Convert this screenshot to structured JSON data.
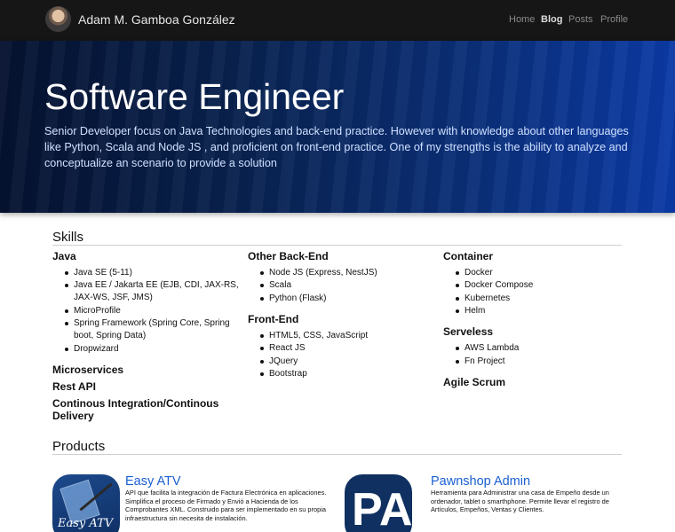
{
  "navbar": {
    "brand": "Adam M. Gamboa González",
    "links": [
      {
        "label": "Home",
        "active": false
      },
      {
        "label": "Blog",
        "active": true
      },
      {
        "label": "Posts",
        "active": false
      },
      {
        "label": "Profile",
        "active": false
      }
    ]
  },
  "hero": {
    "title": "Software Engineer",
    "description": "Senior Developer focus on Java Technologies and back-end practice. However with knowledge about other languages like Python, Scala and Node JS , and proficient on front-end practice. One of my strengths is the ability to analyze and conceptualize an scenario to provide a solution"
  },
  "skills": {
    "title": "Skills",
    "col1": {
      "java": {
        "title": "Java",
        "items": [
          "Java SE (5-11)",
          "Java EE / Jakarta EE (EJB, CDI, JAX-RS,",
          "JAX-WS, JSF, JMS)",
          "MicroProfile",
          "Spring Framework (Spring Core, Spring",
          "boot, Spring Data)",
          "Dropwizard"
        ]
      },
      "microservices": "Microservices",
      "rest": "Rest API",
      "ci_line1": "Continous Integration/Continous",
      "ci_line2": "Delivery"
    },
    "col2": {
      "backend": {
        "title": "Other Back-End",
        "items": [
          "Node JS (Express, NestJS)",
          "Scala",
          "Python (Flask)"
        ]
      },
      "frontend": {
        "title": "Front-End",
        "items": [
          "HTML5, CSS, JavaScript",
          "React JS",
          "JQuery",
          "Bootstrap"
        ]
      }
    },
    "col3": {
      "container": {
        "title": "Container",
        "items": [
          "Docker",
          "Docker Compose",
          "Kubernetes",
          "Helm"
        ]
      },
      "serverless": {
        "title": "Serveless",
        "items": [
          "AWS Lambda",
          "Fn Project"
        ]
      },
      "agile": "Agile Scrum"
    }
  },
  "products": {
    "title": "Products",
    "items": [
      {
        "name": "Easy ATV",
        "logo_text": "Easy ATV",
        "desc_lines": [
          "API que facilita la integración de Factura Electrónica en aplicaciones.",
          "Simplifica el proceso de Firmado y Envió a Hacienda de los",
          "Comprobantes XML. Construido para ser implementado en su propia",
          "infraestructura sin necesita de instalación."
        ]
      },
      {
        "name": "Pawnshop Admin",
        "logo_text": "PA",
        "desc_lines": [
          "Herramienta para Administrar una casa de Empeño desde un",
          "ordenador, tablet o smarthphone. Permite llevar el registro de",
          "Artículos, Empeños, Ventas y Clientes."
        ]
      }
    ]
  },
  "colors": {
    "navbar_bg": "#161616",
    "hero_start": "#051230",
    "hero_end": "#0b3aa6",
    "link": "#1a5fd1"
  }
}
